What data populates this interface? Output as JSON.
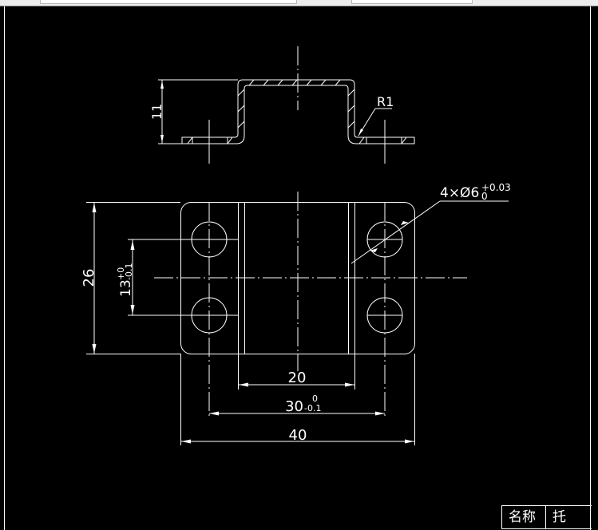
{
  "drawing": {
    "side_view": {
      "height_dim": "11",
      "radius_label": "R1"
    },
    "plan_view": {
      "hole_callout": {
        "main": "4×Ø6",
        "upper_tol": "+0.03",
        "lower_tol": "0"
      },
      "height_dim": "26",
      "hole_spacing_dim": {
        "main": "13",
        "upper_tol": "+0",
        "lower_tol": "-0.1"
      },
      "inner_width_dim": "20",
      "hole_pitch_dim": {
        "main": "30",
        "upper_tol": "0",
        "lower_tol": "-0.1"
      },
      "overall_width_dim": "40"
    }
  },
  "title_block": {
    "name_label": "名称",
    "name_value": "托"
  },
  "colors": {
    "background": "#000000",
    "lines": "#ffffff"
  }
}
